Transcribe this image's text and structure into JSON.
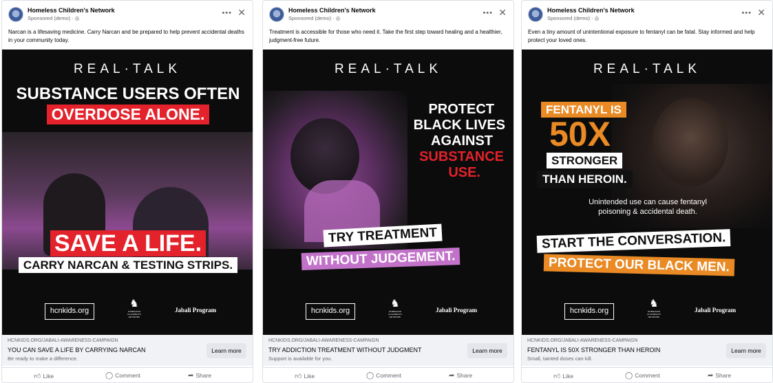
{
  "ads": [
    {
      "page_name": "Homeless Children's Network",
      "sponsored": "Sponsored (demo) · ",
      "globe_icon": "globe-icon",
      "caption": "Narcan is a lifesaving medicine. Carry Narcan and be prepared to help prevent accidental deaths in your community today.",
      "brand": "REAL·TALK",
      "headline_1": "SUBSTANCE USERS OFTEN",
      "headline_2": "OVERDOSE ALONE.",
      "cta_1": "SAVE A LIFE.",
      "cta_2": "CARRY NARCAN & TESTING STRIPS.",
      "site": "hcnkids.org",
      "org_small": "HOMELESS CHILDREN'S NETWORK",
      "program": "Jabali Program",
      "link_url": "HCNKIDS.ORG/JABALI-AWARENESS-CAMPAIGN",
      "link_title": "YOU CAN SAVE A LIFE BY CARRYING NARCAN",
      "link_desc": "Be ready to make a difference.",
      "learn_more": "Learn more"
    },
    {
      "page_name": "Homeless Children's Network",
      "sponsored": "Sponsored (demo) · ",
      "globe_icon": "globe-icon",
      "caption": "Treatment is accessible for those who need it. Take the first step toward healing and a healthier, judgment-free future.",
      "brand": "REAL·TALK",
      "headline_1": "PROTECT",
      "headline_2": "BLACK LIVES",
      "headline_3": "AGAINST",
      "headline_4": "SUBSTANCE",
      "headline_5": "USE.",
      "cta_1": "TRY TREATMENT",
      "cta_2": "WITHOUT JUDGEMENT.",
      "site": "hcnkids.org",
      "org_small": "HOMELESS CHILDREN'S NETWORK",
      "program": "Jabali Program",
      "link_url": "HCNKIDS.ORG/JABALI-AWARENESS-CAMPAIGN",
      "link_title": "TRY ADDICTION TREATMENT WITHOUT JUDGMENT",
      "link_desc": "Support is available for you.",
      "learn_more": "Learn more"
    },
    {
      "page_name": "Homeless Children's Network",
      "sponsored": "Sponsored (demo) · ",
      "globe_icon": "globe-icon",
      "caption": "Even a tiny amount of unintentional exposure to fentanyl can be fatal. Stay informed and help protect your loved ones.",
      "brand": "REAL·TALK",
      "headline_1": "FENTANYL IS",
      "headline_2": "50X",
      "headline_3": "STRONGER",
      "headline_4": "THAN HEROIN.",
      "sub_1": "Unintended use can cause fentanyl",
      "sub_2": "poisoning & accidental death.",
      "cta_1": "START THE CONVERSATION.",
      "cta_2": "PROTECT OUR BLACK MEN.",
      "site": "hcnkids.org",
      "org_small": "HOMELESS CHILDREN'S NETWORK",
      "program": "Jabali Program",
      "link_url": "HCNKIDS.ORG/JABALI-AWARENESS-CAMPAIGN",
      "link_title": "FENTANYL IS 50X STRONGER THAN HEROIN",
      "link_desc": "Small, tainted doses can kill.",
      "learn_more": "Learn more"
    }
  ],
  "actions": {
    "like": "Like",
    "comment": "Comment",
    "share": "Share"
  },
  "colors": {
    "red": "#e3222b",
    "pink": "#c273c9",
    "orange": "#e98a25",
    "magenta_tint": "#b44bb8",
    "link_bar": "#f0f2f5"
  }
}
